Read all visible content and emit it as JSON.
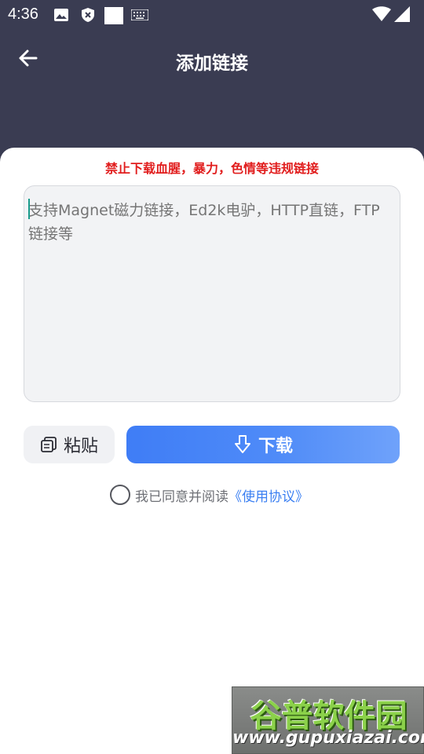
{
  "status_bar": {
    "time": "4:36"
  },
  "header": {
    "title": "添加链接"
  },
  "warning_text": "禁止下载血腥，暴力，色情等违规链接",
  "link_input": {
    "placeholder": "支持Magnet磁力链接，Ed2k电驴，HTTP直链，FTP链接等"
  },
  "actions": {
    "paste_label": "粘贴",
    "download_label": "下载"
  },
  "agreement": {
    "text": "我已同意并阅读",
    "link": "《使用协议》"
  },
  "watermark": {
    "brand": "谷普软件园",
    "url": "www.gupuxiazai.com"
  },
  "colors": {
    "header_bg": "#3a3c52",
    "warning": "#e11d1d",
    "accent": "#3f7df6"
  }
}
